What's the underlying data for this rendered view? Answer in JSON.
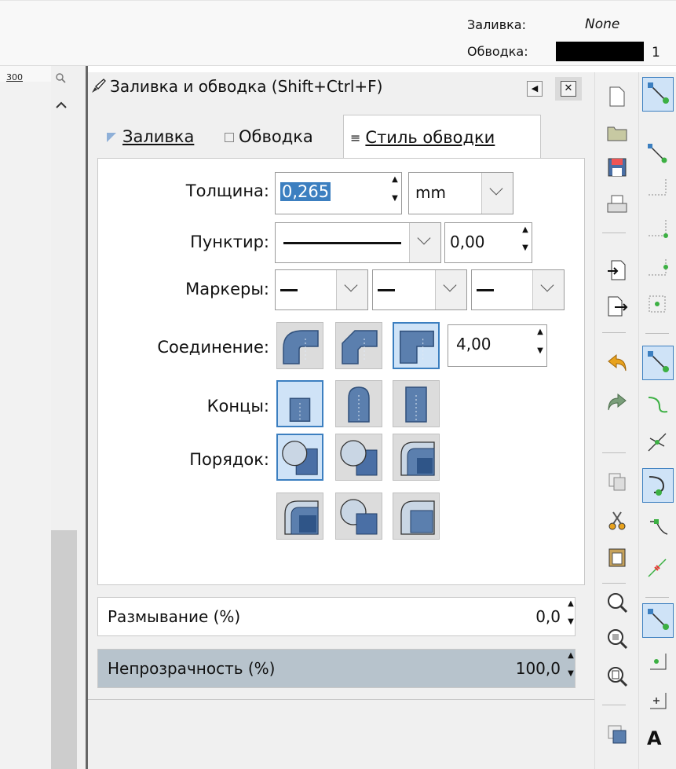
{
  "statusbar": {
    "fill_label": "Заливка:",
    "fill_value": "None",
    "stroke_label": "Обводка:",
    "stroke_width": "1",
    "stroke_color": "#000000"
  },
  "ruler": {
    "label": "300"
  },
  "dialog": {
    "title": "Заливка и обводка (Shift+Ctrl+F)",
    "tabs": [
      {
        "label": "Заливка",
        "underline": "З"
      },
      {
        "label": "Обводка",
        "underline": "в"
      },
      {
        "label": "Стиль обводки",
        "underline": "С"
      }
    ],
    "fields": {
      "width_label": "Толщина:",
      "width_value": "0,265",
      "unit": "mm",
      "dash_label": "Пунктир:",
      "dash_offset": "0,00",
      "markers_label": "Маркеры:",
      "join_label": "Соединение:",
      "miter_value": "4,00",
      "caps_label": "Концы:",
      "order_label": "Порядок:"
    },
    "blur": {
      "label": "Размывание (%)",
      "value": "0,0"
    },
    "opacity": {
      "label": "Непрозрачность (%)",
      "value": "100,0",
      "fill_color": "#b7c3cc",
      "level_percent": 100
    }
  },
  "colors": {
    "accent": "#3c7fc0",
    "selection": "#3c7fc0",
    "icon_blue": "#5b7fae"
  }
}
